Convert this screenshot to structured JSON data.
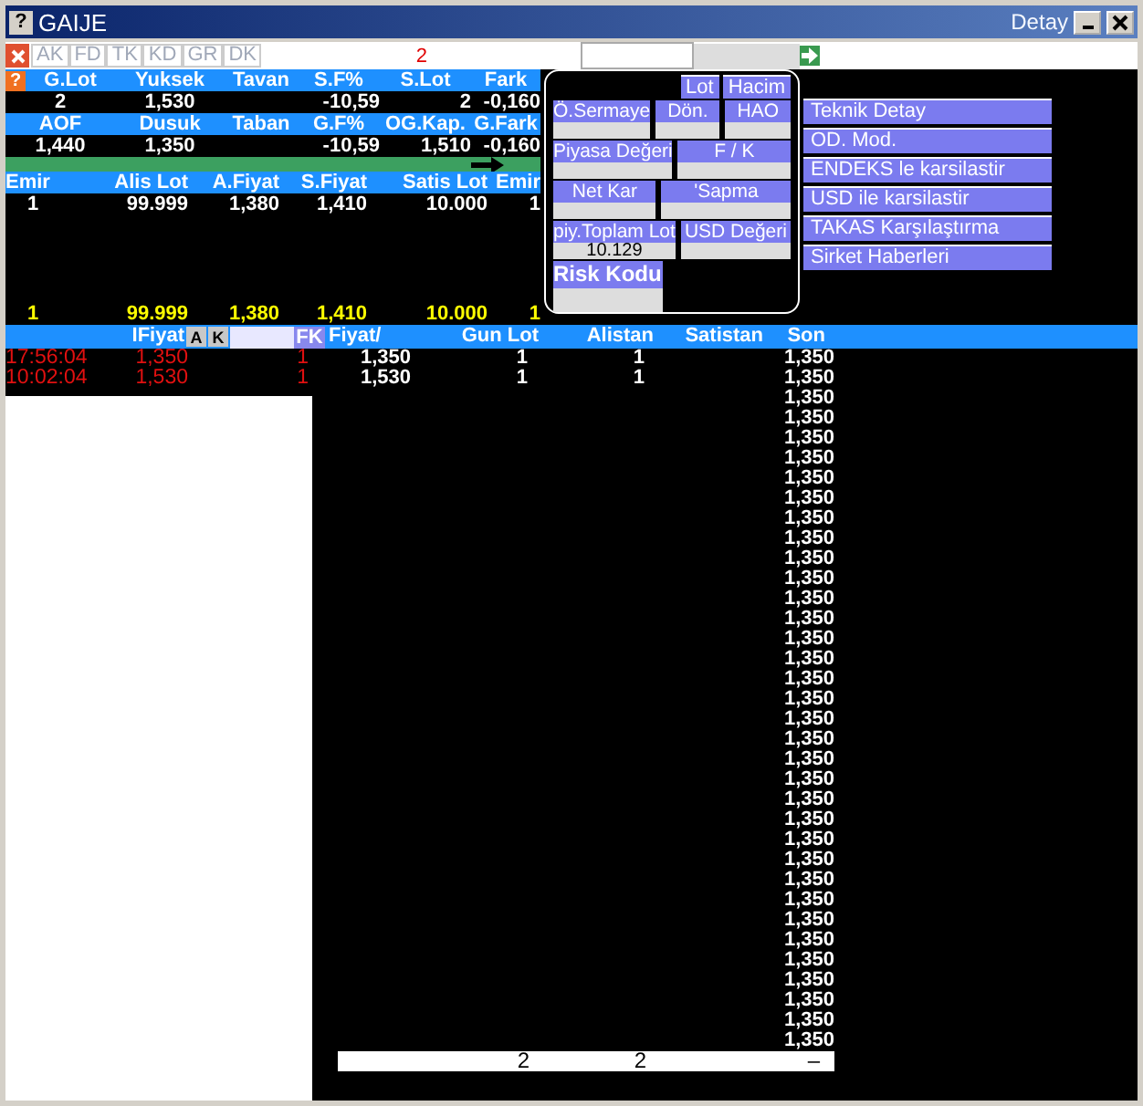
{
  "window": {
    "help_glyph": "?",
    "title": "GAIJE",
    "right_title": "Detay"
  },
  "toolbar": {
    "tabs": [
      {
        "label": "AK",
        "disabled": true
      },
      {
        "label": "FD",
        "disabled": true
      },
      {
        "label": "TK",
        "disabled": true
      },
      {
        "label": "KD",
        "disabled": true
      },
      {
        "label": "GR",
        "disabled": true
      },
      {
        "label": "DK",
        "disabled": true
      }
    ],
    "count": "2"
  },
  "quote": {
    "help_glyph": "?",
    "row1": [
      {
        "header": "G.Lot",
        "value": "2"
      },
      {
        "header": "Yuksek",
        "value": "1,530"
      },
      {
        "header": "Tavan"
      },
      {
        "header": "S.F%",
        "value": "-10,59"
      },
      {
        "header": "S.Lot",
        "value": "2"
      },
      {
        "header": "Fark",
        "value": "-0,160"
      }
    ],
    "row2": [
      {
        "header": "AOF",
        "value": "1,440"
      },
      {
        "header": "Dusuk",
        "value": "1,350"
      },
      {
        "header": "Taban"
      },
      {
        "header": "G.F%",
        "value": "-10,59"
      },
      {
        "header": "OG.Kap.",
        "value": "1,510"
      },
      {
        "header": "G.Fark",
        "value": "-0,160"
      }
    ]
  },
  "depth": {
    "columns": [
      "Emir",
      "Alis Lot",
      "A.Fiyat",
      "S.Fiyat",
      "Satis Lot",
      "Emir"
    ],
    "rows": [
      [
        "1",
        "99.999",
        "1,380",
        "1,410",
        "10.000",
        "1"
      ]
    ],
    "totals": [
      "1",
      "99.999",
      "1,380",
      "1,410",
      "10.000",
      "1"
    ]
  },
  "detail": {
    "buttons": [
      "Lot",
      "Hacim"
    ],
    "rows": [
      [
        {
          "kind": "field",
          "label": "Ö.Sermaye"
        },
        {
          "kind": "field",
          "label": "Dön."
        },
        {
          "kind": "field",
          "label": "HAO"
        }
      ],
      [
        {
          "kind": "field",
          "label": "Piyasa Değeri"
        },
        {
          "kind": "field",
          "label": "F / K"
        }
      ],
      [
        {
          "kind": "field",
          "label": "Net Kar"
        },
        {
          "kind": "field",
          "label": "'Sapma"
        }
      ],
      [
        {
          "kind": "field",
          "label": "piy.Toplam Lot",
          "value": "10.129"
        },
        {
          "kind": "field",
          "label": "USD Değeri"
        }
      ],
      [
        {
          "kind": "risk",
          "label": "Risk Kodu"
        }
      ]
    ]
  },
  "menu": [
    "Teknik Detay",
    "OD. Mod.",
    "ENDEKS le karsilastir",
    "USD ile karsilastir",
    "TAKAS Karşılaştırma",
    "Sirket Haberleri"
  ],
  "trades": {
    "header": "IFiyat",
    "buttons": [
      "A",
      "K"
    ],
    "fk": "FK",
    "rows": [
      [
        "17:56:04",
        "1,350",
        "1"
      ],
      [
        "10:02:04",
        "1,530",
        "1"
      ]
    ]
  },
  "prices": {
    "columns": [
      "Fiyat/",
      "Gun Lot",
      "Alistan",
      "Satistan",
      "Son"
    ],
    "rows": [
      [
        "1,350",
        "1",
        "1"
      ],
      [
        "1,530",
        "1",
        "1"
      ]
    ],
    "son": [
      "1,350",
      "1,350",
      "1,350",
      "1,350",
      "1,350",
      "1,350",
      "1,350",
      "1,350",
      "1,350",
      "1,350",
      "1,350",
      "1,350",
      "1,350",
      "1,350",
      "1,350",
      "1,350",
      "1,350",
      "1,350",
      "1,350",
      "1,350",
      "1,350",
      "1,350",
      "1,350",
      "1,350",
      "1,350",
      "1,350",
      "1,350",
      "1,350",
      "1,350",
      "1,350",
      "1,350",
      "1,350",
      "1,350",
      "1,350",
      "1,350"
    ],
    "totals": [
      "2",
      "2",
      "–"
    ]
  }
}
